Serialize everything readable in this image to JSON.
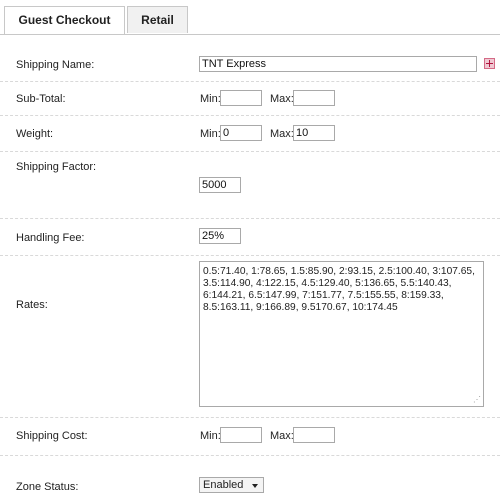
{
  "tabs": {
    "guest": "Guest Checkout",
    "retail": "Retail"
  },
  "shipping_name": {
    "label": "Shipping Name:",
    "value": "TNT Express"
  },
  "subtotal": {
    "label": "Sub-Total:",
    "min_label": "Min:",
    "min_value": "",
    "max_label": "Max:",
    "max_value": ""
  },
  "weight": {
    "label": "Weight:",
    "min_label": "Min:",
    "min_value": "0",
    "max_label": "Max:",
    "max_value": "10"
  },
  "shipping_factor": {
    "label": "Shipping Factor:",
    "value": "5000"
  },
  "handling_fee": {
    "label": "Handling Fee:",
    "value": "25%"
  },
  "rates": {
    "label": "Rates:",
    "value": "0.5:71.40, 1:78.65, 1.5:85.90, 2:93.15, 2.5:100.40, 3:107.65, 3.5:114.90, 4:122.15, 4.5:129.40, 5:136.65, 5.5:140.43, 6:144.21, 6.5:147.99, 7:151.77, 7.5:155.55, 8:159.33, 8.5:163.11, 9:166.89, 9.5170.67, 10:174.45"
  },
  "shipping_cost": {
    "label": "Shipping Cost:",
    "min_label": "Min:",
    "min_value": "",
    "max_label": "Max:",
    "max_value": ""
  },
  "zone_status": {
    "label": "Zone Status:",
    "selected": "Enabled"
  },
  "icons": {
    "add": "plus-icon",
    "dropdown": "chevron-down-icon",
    "resize": "resize-grip-icon"
  }
}
